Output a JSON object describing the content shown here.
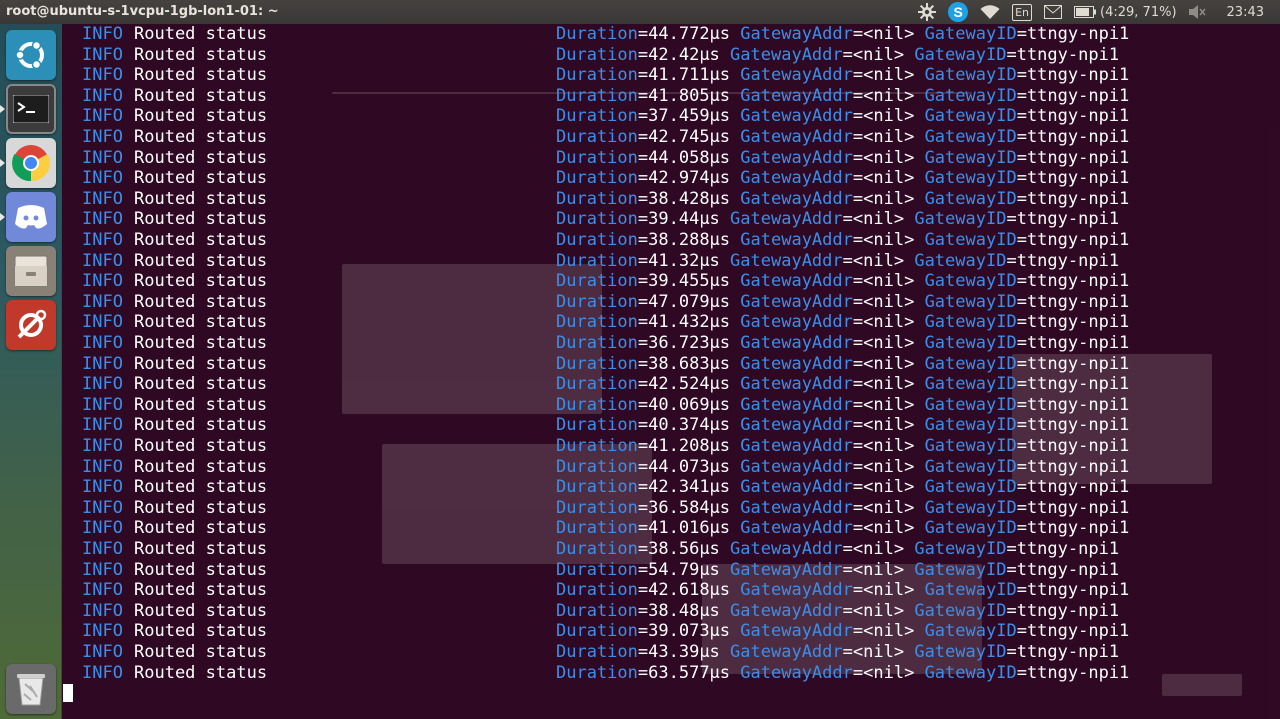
{
  "window": {
    "title": "root@ubuntu-s-1vcpu-1gb-lon1-01: ~"
  },
  "panel": {
    "keyboard_layout": "En",
    "battery": "(4:29, 71%)",
    "clock": "23:43",
    "icons": [
      "settings-icon",
      "skype-icon",
      "wifi-icon",
      "keyboard-icon",
      "mail-icon",
      "battery-icon",
      "volume-muted-icon"
    ]
  },
  "launcher": {
    "items": [
      {
        "name": "ubuntu-dash",
        "icon": "ubuntu-logo-icon",
        "color": "#2b8fb8"
      },
      {
        "name": "terminal",
        "icon": "terminal-icon",
        "color": "#3c3c3c"
      },
      {
        "name": "chrome",
        "icon": "chrome-icon",
        "color": "#d8d8d8"
      },
      {
        "name": "discord",
        "icon": "discord-icon",
        "color": "#7289da"
      },
      {
        "name": "files",
        "icon": "files-icon",
        "color": "#8a8176"
      },
      {
        "name": "system-settings",
        "icon": "settings-tools-icon",
        "color": "#c0392b"
      },
      {
        "name": "trash",
        "icon": "trash-icon",
        "color": "#6a6a6a"
      }
    ]
  },
  "colors": {
    "key": "#3b8eea",
    "value": "#ffffff",
    "background": "#300a24"
  },
  "log": {
    "level": "INFO",
    "message": "Routed status",
    "key_duration": "Duration",
    "key_gateway_addr": "GatewayAddr",
    "key_gateway_id": "GatewayID",
    "gateway_addr": "<nil>",
    "gateway_id": "ttngy-npi1",
    "durations": [
      "44.772µs",
      "42.42µs",
      "41.711µs",
      "41.805µs",
      "37.459µs",
      "42.745µs",
      "44.058µs",
      "42.974µs",
      "38.428µs",
      "39.44µs",
      "38.288µs",
      "41.32µs",
      "39.455µs",
      "47.079µs",
      "41.432µs",
      "36.723µs",
      "38.683µs",
      "42.524µs",
      "40.069µs",
      "40.374µs",
      "41.208µs",
      "44.073µs",
      "42.341µs",
      "36.584µs",
      "41.016µs",
      "38.56µs",
      "54.79µs",
      "42.618µs",
      "38.48µs",
      "39.073µs",
      "43.39µs",
      "63.577µs"
    ]
  }
}
